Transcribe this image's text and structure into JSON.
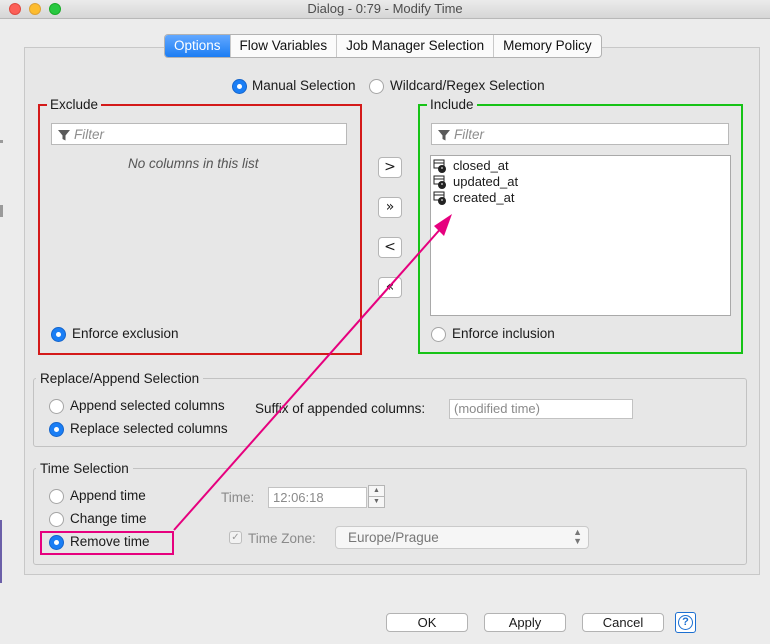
{
  "window": {
    "title": "Dialog - 0:79 - Modify Time"
  },
  "tabs": [
    {
      "label": "Options",
      "active": true
    },
    {
      "label": "Flow Variables"
    },
    {
      "label": "Job Manager Selection"
    },
    {
      "label": "Memory Policy"
    }
  ],
  "selection_mode": {
    "manual": "Manual Selection",
    "wildcard": "Wildcard/Regex Selection",
    "selected": "manual"
  },
  "exclude": {
    "title": "Exclude",
    "filter_placeholder": "Filter",
    "empty_text": "No columns in this list",
    "enforce_label": "Enforce exclusion",
    "enforce_selected": true
  },
  "include": {
    "title": "Include",
    "filter_placeholder": "Filter",
    "columns": [
      "closed_at",
      "updated_at",
      "created_at"
    ],
    "enforce_label": "Enforce inclusion",
    "enforce_selected": false
  },
  "move_buttons": {
    "add": ">",
    "add_all": "»",
    "remove": "<",
    "remove_all": "«"
  },
  "replace_append": {
    "title": "Replace/Append Selection",
    "append_label": "Append selected columns",
    "replace_label": "Replace selected columns",
    "selected": "replace",
    "suffix_label": "Suffix of appended columns:",
    "suffix_value": "(modified time)"
  },
  "time_selection": {
    "title": "Time Selection",
    "append_label": "Append time",
    "change_label": "Change time",
    "remove_label": "Remove time",
    "selected": "remove",
    "time_label": "Time:",
    "time_value": "12:06:18",
    "timezone_label": "Time Zone:",
    "timezone_value": "Europe/Prague",
    "timezone_checked": true
  },
  "buttons": {
    "ok": "OK",
    "apply": "Apply",
    "cancel": "Cancel"
  },
  "colors": {
    "accent": "#1a7ef5",
    "exclude_border": "#d41a1a",
    "include_border": "#17c317",
    "annotation": "#e6007e"
  },
  "icons": {
    "filter": "filter-icon",
    "column": "datetime-column-icon",
    "help": "help-icon"
  }
}
